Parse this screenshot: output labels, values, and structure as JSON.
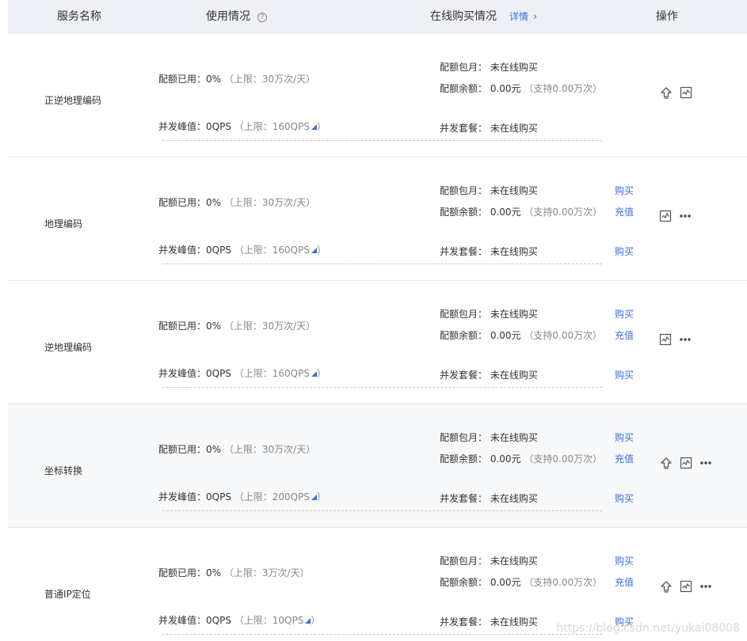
{
  "header": {
    "name": "服务名称",
    "usage": "使用情况",
    "usage_help": "?",
    "buy": "在线购买情况",
    "detail_link": "详情",
    "detail_arrow": "›",
    "ops": "操作"
  },
  "labels": {
    "quota_used": "配额已用：",
    "concurrency_peak": "并发峰值：",
    "monthly": "配额包月：",
    "balance": "配额余额：",
    "package": "并发套餐：",
    "not_bought": "未在线购买"
  },
  "rows": [
    {
      "name": "正逆地理编码",
      "used": "0%",
      "limit": "（上限：30万次/天）",
      "qps": "0QPS",
      "qps_limit": "（上限：160QPS",
      "qps_limit_end": "）",
      "balance": "0.00元",
      "balance_note": "（支持0.00万次）",
      "links": null,
      "ops": [
        "upgrade-icon",
        "chart-icon"
      ]
    },
    {
      "name": "地理编码",
      "used": "0%",
      "limit": "（上限：30万次/天）",
      "qps": "0QPS",
      "qps_limit": "（上限：160QPS",
      "qps_limit_end": "）",
      "balance": "0.00元",
      "balance_note": "（支持0.00万次）",
      "links": {
        "monthly": "购买",
        "balance": "充值",
        "package": "购买"
      },
      "ops": [
        "chart-icon",
        "more-icon"
      ]
    },
    {
      "name": "逆地理编码",
      "used": "0%",
      "limit": "（上限：30万次/天）",
      "qps": "0QPS",
      "qps_limit": "（上限：160QPS",
      "qps_limit_end": "）",
      "balance": "0.00元",
      "balance_note": "（支持0.00万次）",
      "links": {
        "monthly": "购买",
        "balance": "充值",
        "package": "购买"
      },
      "ops": [
        "chart-icon",
        "more-icon"
      ]
    },
    {
      "name": "坐标转换",
      "used": "0%",
      "limit": "（上限：30万次/天）",
      "qps": "0QPS",
      "qps_limit": "（上限：200QPS",
      "qps_limit_end": "）",
      "balance": "0.00元",
      "balance_note": "（支持0.00万次）",
      "links": {
        "monthly": "购买",
        "balance": "充值",
        "package": "购买"
      },
      "ops": [
        "upgrade-icon",
        "chart-icon",
        "more-icon"
      ]
    },
    {
      "name": "普通IP定位",
      "used": "0%",
      "limit": "（上限：3万次/天）",
      "qps": "0QPS",
      "qps_limit": "（上限：10QPS",
      "qps_limit_end": "）",
      "balance": "0.00元",
      "balance_note": "（支持0.00万次）",
      "links": {
        "monthly": "购买",
        "balance": "充值",
        "package": "购买"
      },
      "ops": [
        "upgrade-icon",
        "chart-icon",
        "more-icon"
      ]
    }
  ],
  "watermark": "https://blog.csdn.net/yukai08008",
  "colors": {
    "link": "#3b6fd8",
    "header_bg": "#eef0f5",
    "highlight_row": "#f7f8fa"
  }
}
